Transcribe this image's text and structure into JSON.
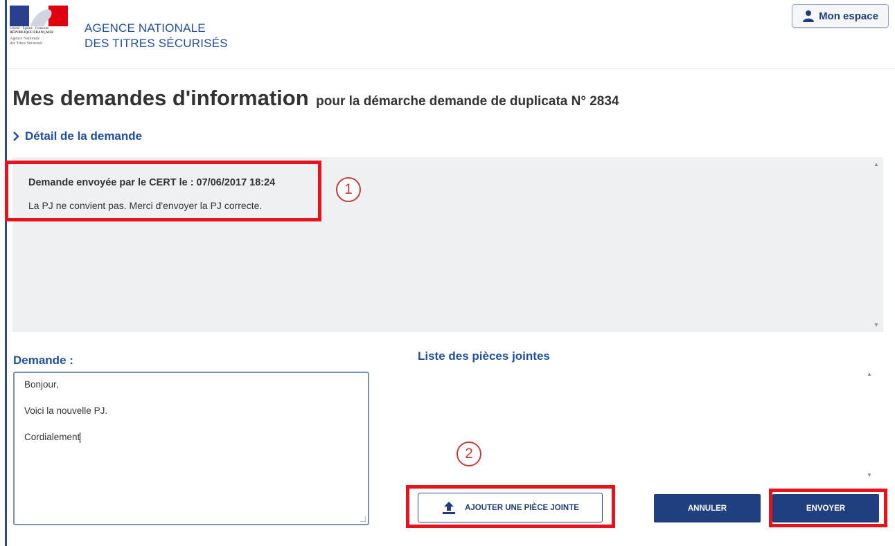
{
  "header": {
    "logo": {
      "motto": "Liberté · Égalité · Fraternité",
      "republic": "RÉPUBLIQUE FRANÇAISE",
      "agency_line1": "Agence Nationale",
      "agency_line2": "des Titres Sécurisés"
    },
    "agency_line1": "AGENCE NATIONALE",
    "agency_line2": "DES TITRES SÉCURISÉS",
    "account_button": "Mon espace"
  },
  "page": {
    "title": "Mes demandes d'information",
    "subtitle": "pour la démarche demande de duplicata N° 2834",
    "detail_link": "Détail de la demande"
  },
  "message": {
    "header": "Demande envoyée par le CERT le : 07/06/2017 18:24",
    "body": "La PJ ne convient pas. Merci d'envoyer la PJ correcte."
  },
  "form": {
    "demande_label": "Demande :",
    "demande_lines": [
      "Bonjour,",
      "Voici la nouvelle PJ.",
      "Cordialement"
    ],
    "attachments_label": "Liste des pièces jointes",
    "add_attachment_button": "AJOUTER UNE PIÈCE JOINTE",
    "cancel_button": "ANNULER",
    "send_button": "ENVOYER"
  },
  "annotations": [
    "1",
    "2"
  ],
  "colors": {
    "brand_blue": "#1f4fa3",
    "button_dark": "#1f3f7e",
    "annotation_red": "#e8121c",
    "panel_gray": "#eef0f1"
  },
  "icons": [
    "user-icon",
    "chevron-right-icon",
    "upload-icon",
    "scroll-up-icon",
    "scroll-down-icon"
  ]
}
